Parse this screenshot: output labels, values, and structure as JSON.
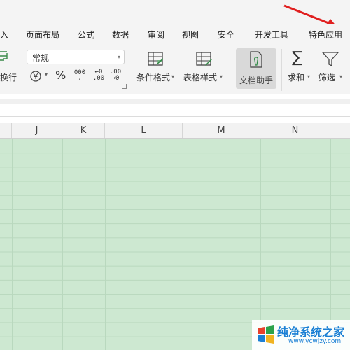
{
  "menu": {
    "tabs": [
      "入",
      "页面布局",
      "公式",
      "数据",
      "审阅",
      "视图",
      "安全",
      "开发工具",
      "特色应用"
    ]
  },
  "ribbon": {
    "wrap_label": "换行",
    "number_format_value": "常规",
    "percent_symbol": "%",
    "thousands_symbol": "000",
    "decimal_increase_top": "←0",
    "decimal_increase_bottom": ".00",
    "decimal_decrease_top": ".00",
    "decimal_decrease_bottom": "→0",
    "conditional_format_label": "条件格式",
    "table_style_label": "表格样式",
    "doc_helper_label": "文档助手",
    "sum_label": "求和",
    "filter_label": "筛选",
    "dropdown_caret": "▾"
  },
  "sheet": {
    "columns": [
      "J",
      "K",
      "L",
      "M",
      "N"
    ]
  },
  "colors": {
    "grid_fill": "#cde8d1",
    "arrow": "#e02020",
    "watermark_blue": "#1a7fd4"
  },
  "watermark": {
    "text": "纯净系统之家",
    "url": "www.ycwjzy.com"
  }
}
